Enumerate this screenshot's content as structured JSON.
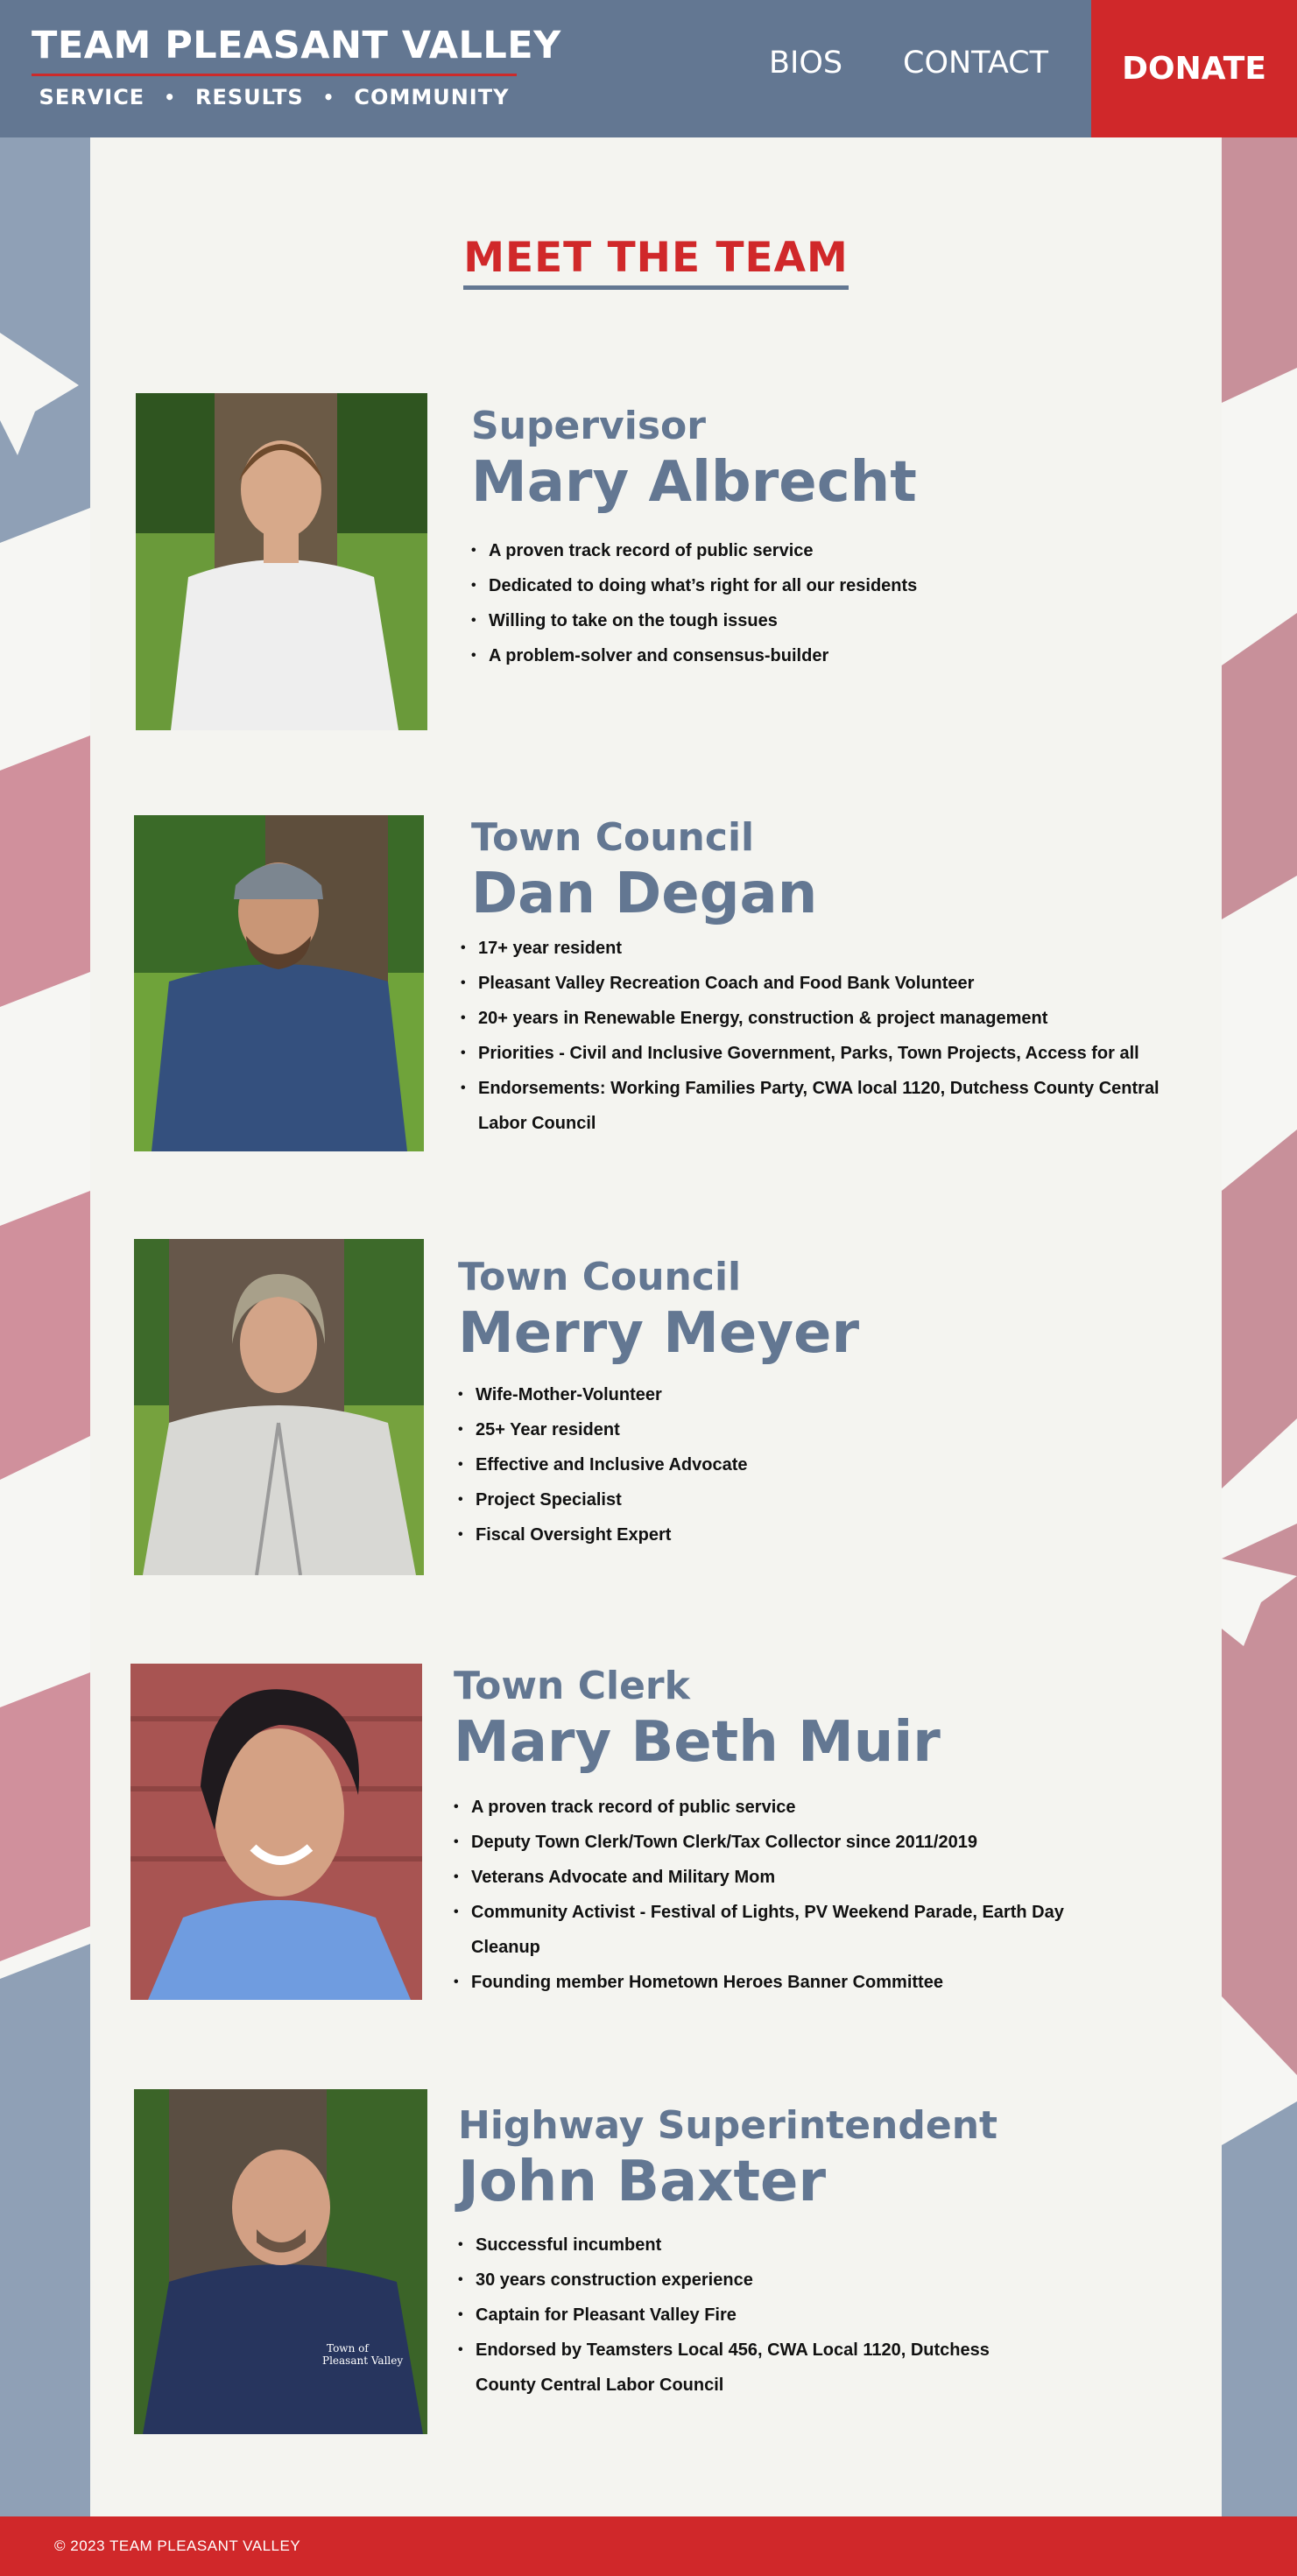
{
  "brand": {
    "title": "TEAM PLEASANT  VALLEY",
    "tagline": [
      "SERVICE",
      "RESULTS",
      "COMMUNITY"
    ]
  },
  "nav": {
    "bios": "BIOS",
    "contact": "CONTACT",
    "donate": "DONATE"
  },
  "section_title": "MEET THE TEAM",
  "members": [
    {
      "role": "Supervisor",
      "name": "Mary Albrecht",
      "points": [
        "A proven track record of public service",
        "Dedicated to doing what’s right for all our residents",
        "Willing to take on the tough issues",
        "A problem-solver and consensus-builder"
      ]
    },
    {
      "role": "Town Council",
      "name": "Dan Degan",
      "points": [
        "17+ year resident",
        "Pleasant Valley Recreation Coach and Food Bank Volunteer",
        "20+ years in Renewable Energy, construction & project management",
        "Priorities - Civil and Inclusive Government, Parks, Town Projects, Access for all",
        "Endorsements: Working Families Party, CWA local 1120,  Dutchess County Central Labor Council"
      ]
    },
    {
      "role": "Town Council",
      "name": "Merry Meyer",
      "points": [
        "Wife-Mother-Volunteer",
        "25+ Year resident",
        "Effective and Inclusive Advocate",
        "Project Specialist",
        "Fiscal Oversight Expert"
      ]
    },
    {
      "role": "Town Clerk",
      "name": "Mary Beth Muir",
      "points": [
        "A proven track record of public service",
        "Deputy Town Clerk/Town Clerk/Tax Collector since 2011/2019",
        "Veterans Advocate and Military Mom",
        "Community Activist - Festival of Lights, PV Weekend Parade, Earth Day Cleanup",
        "Founding member Hometown Heroes Banner Committee"
      ]
    },
    {
      "role": "Highway Superintendent",
      "name": "John Baxter",
      "points": [
        "Successful incumbent",
        "30 years construction experience",
        "Captain for Pleasant Valley Fire",
        "Endorsed by Teamsters Local 456, CWA Local 1120, Dutchess County Central Labor Council"
      ]
    }
  ],
  "footer": {
    "copyright": "© 2023 TEAM PLEASANT VALLEY"
  },
  "colors": {
    "brand_blue": "#637792",
    "brand_red": "#d0282a",
    "panel": "#f4f4f0"
  }
}
